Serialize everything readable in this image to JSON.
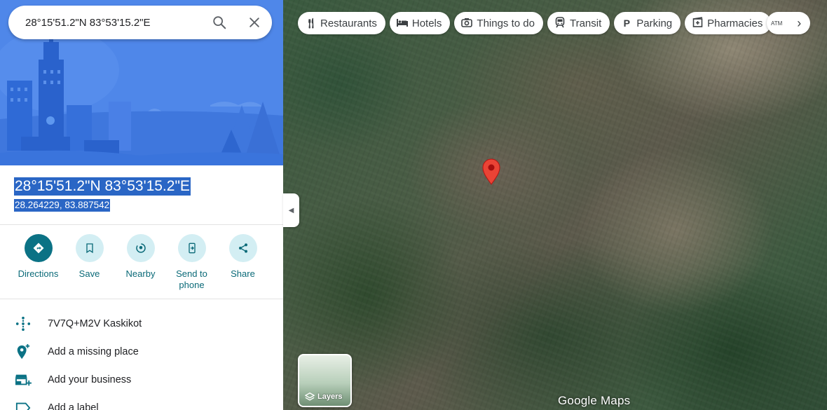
{
  "search": {
    "value": "28°15'51.2\"N 83°53'15.2\"E"
  },
  "place": {
    "title": "28°15'51.2\"N 83°53'15.2\"E",
    "subtitle": "28.264229, 83.887542"
  },
  "actions": [
    {
      "label": "Directions"
    },
    {
      "label": "Save"
    },
    {
      "label": "Nearby"
    },
    {
      "label": "Send to phone"
    },
    {
      "label": "Share"
    }
  ],
  "info_rows": [
    {
      "label": "7V7Q+M2V Kaskikot",
      "icon": "plus-code-icon"
    },
    {
      "label": "Add a missing place",
      "icon": "add-place-icon"
    },
    {
      "label": "Add your business",
      "icon": "add-business-icon"
    },
    {
      "label": "Add a label",
      "icon": "label-icon"
    }
  ],
  "chips": [
    {
      "label": "Restaurants",
      "icon": "fork-knife-icon"
    },
    {
      "label": "Hotels",
      "icon": "bed-icon"
    },
    {
      "label": "Things to do",
      "icon": "camera-icon"
    },
    {
      "label": "Transit",
      "icon": "train-icon"
    },
    {
      "label": "Parking",
      "icon": "parking-icon"
    },
    {
      "label": "Pharmacies",
      "icon": "pharmacy-icon"
    }
  ],
  "chip_more_label": "ATM",
  "layers_label": "Layers",
  "brand": "Google Maps",
  "colors": {
    "accent": "#0b7285",
    "selection": "#2a66c5",
    "hero_bg": "#4e86e8",
    "pin": "#ea4335"
  }
}
